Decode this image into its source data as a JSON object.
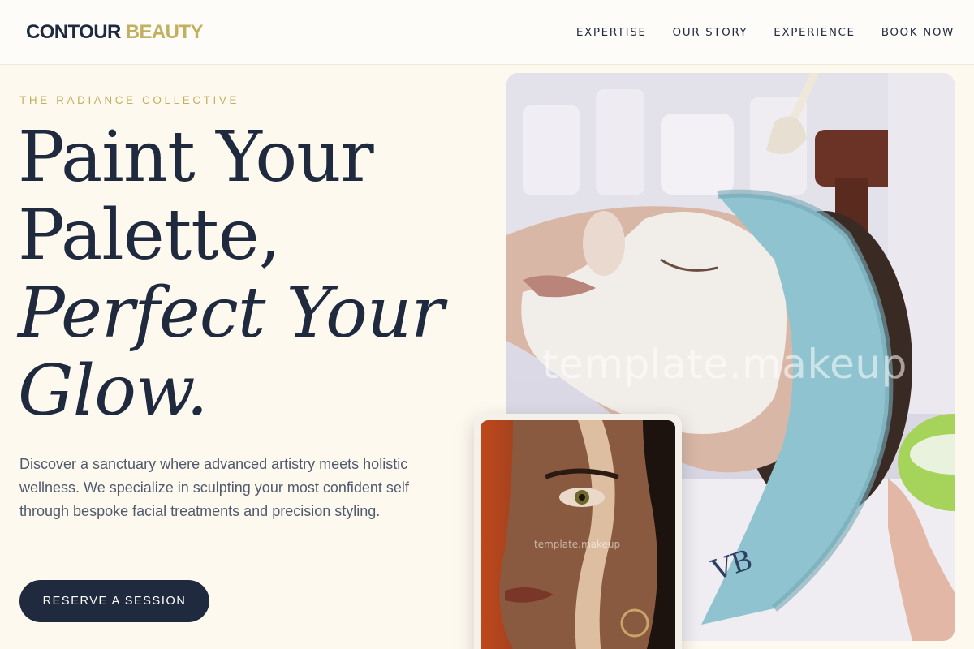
{
  "brand": {
    "logo_word1": "CONTOUR",
    "logo_word2": "BEAUTY",
    "accent_color": "#c2b060",
    "primary_color": "#1f2a3f"
  },
  "nav": {
    "items": [
      {
        "label": "EXPERTISE"
      },
      {
        "label": "OUR STORY"
      },
      {
        "label": "EXPERIENCE"
      },
      {
        "label": "BOOK NOW"
      }
    ]
  },
  "hero": {
    "eyebrow": "THE RADIANCE COLLECTIVE",
    "headline_line1": "Paint Your",
    "headline_line2": "Palette,",
    "headline_line3": "Perfect Your",
    "headline_line4": "Glow.",
    "description": "Discover a sanctuary where advanced artistry meets holistic wellness. We specialize in sculpting your most confident self through bespoke facial treatments and precision styling.",
    "cta_label": "RESERVE A SESSION"
  },
  "images": {
    "main_watermark": "template.makeup",
    "card_watermark": "template.makeup",
    "towel_text": "VB"
  }
}
